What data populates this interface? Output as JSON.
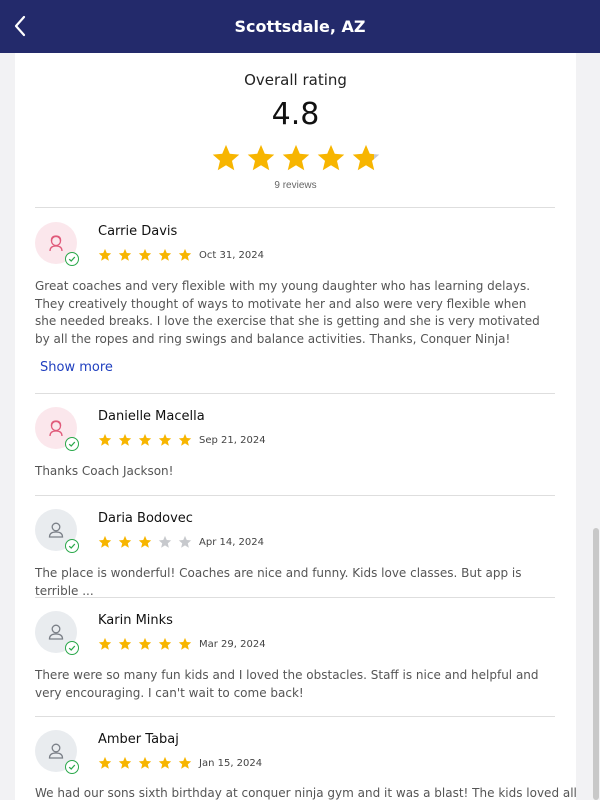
{
  "header": {
    "title": "Scottsdale, AZ",
    "back_icon": "chevron-left-icon"
  },
  "summary": {
    "label": "Overall rating",
    "score": "4.8",
    "rating_value": 4.8,
    "count": "9 reviews"
  },
  "colors": {
    "header_bg": "#232a6b",
    "star": "#f7b500",
    "star_empty": "#c7c9cd",
    "link": "#1f3fbf",
    "verified": "#2aa84a"
  },
  "reviews": [
    {
      "name": "Carrie Davis",
      "rating": 5,
      "date": "Oct 31, 2024",
      "avatar": "female-avatar-icon",
      "text": "Great coaches and very flexible with my young daughter who has learning delays. They creatively thought of ways to motivate her and also were very flexible when she needed breaks. I love the exercise that she is getting and she is very motivated by all the ropes and ring swings and balance activities. Thanks, Conquer Ninja!",
      "show_more": "Show more"
    },
    {
      "name": "Danielle Macella",
      "rating": 5,
      "date": "Sep 21, 2024",
      "avatar": "female-avatar-icon",
      "text": "Thanks Coach Jackson!"
    },
    {
      "name": "Daria Bodovec",
      "rating": 3,
      "date": "Apr 14, 2024",
      "avatar": "person-avatar-icon",
      "text": "The place is wonderful! Coaches are nice and funny. Kids love classes. But app is terrible ..."
    },
    {
      "name": "Karin Minks",
      "rating": 5,
      "date": "Mar 29, 2024",
      "avatar": "person-avatar-icon",
      "text": "There were so many fun kids and I loved the obstacles. Staff is nice and helpful and very encouraging. I can't wait to come back!"
    },
    {
      "name": "Amber Tabaj",
      "rating": 5,
      "date": "Jan 15, 2024",
      "avatar": "person-avatar-icon",
      "text": "We had our sons sixth birthday at conquer ninja gym and it was a blast! The kids loved all the"
    }
  ]
}
